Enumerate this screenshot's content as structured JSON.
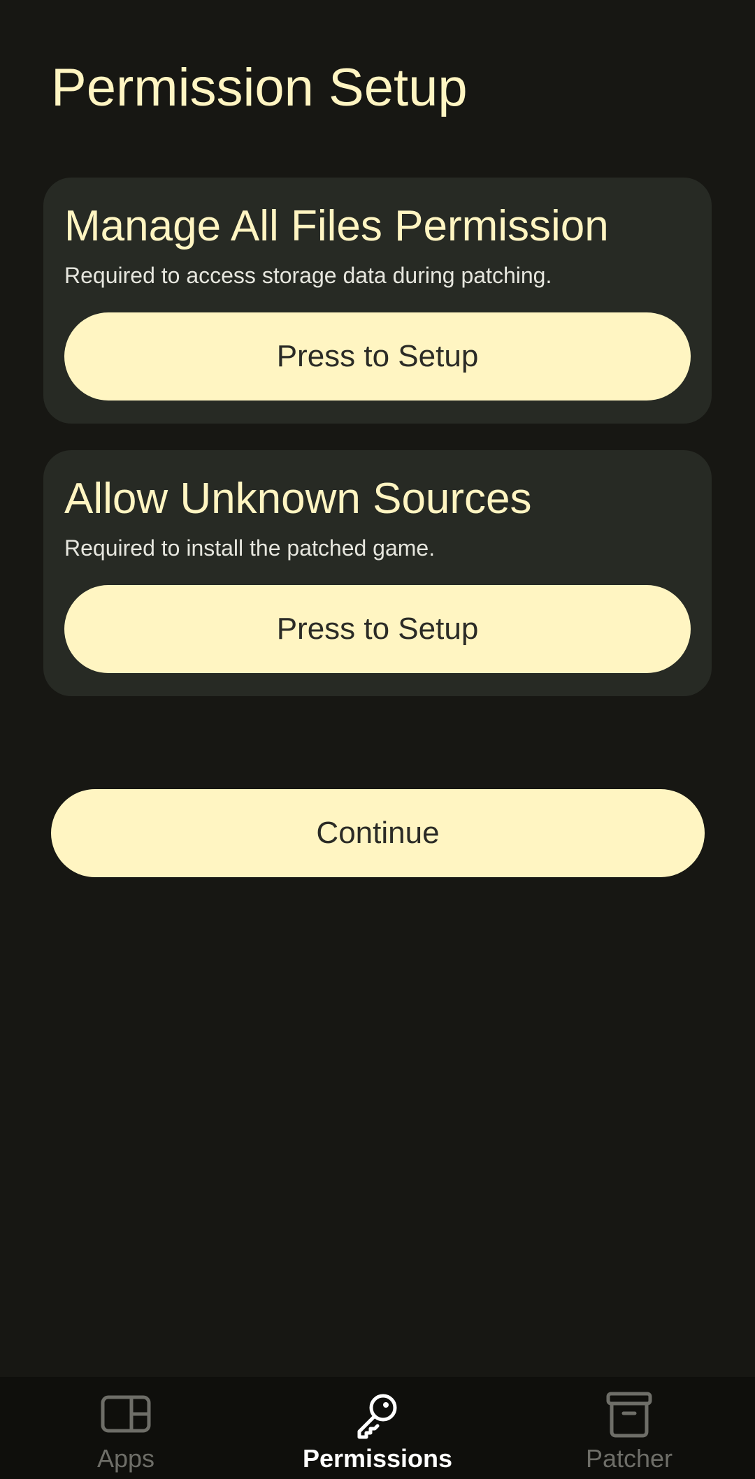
{
  "header": {
    "title": "Permission Setup"
  },
  "permissions": [
    {
      "title": "Manage All Files Permission",
      "description": "Required to access storage data during patching.",
      "button_label": "Press to Setup"
    },
    {
      "title": "Allow Unknown Sources",
      "description": "Required to install the patched game.",
      "button_label": "Press to Setup"
    }
  ],
  "actions": {
    "continue_label": "Continue"
  },
  "bottom_nav": {
    "items": [
      {
        "label": "Apps",
        "icon": "apps-window-icon",
        "active": false
      },
      {
        "label": "Permissions",
        "icon": "key-icon",
        "active": true
      },
      {
        "label": "Patcher",
        "icon": "archive-box-icon",
        "active": false
      }
    ]
  },
  "colors": {
    "background": "#171713",
    "card": "#272a24",
    "accent": "#fff5c2",
    "button_text": "#2b2b26",
    "nav_background": "#0f0f0c",
    "nav_inactive": "#6e6e68",
    "nav_active": "#ffffff"
  }
}
